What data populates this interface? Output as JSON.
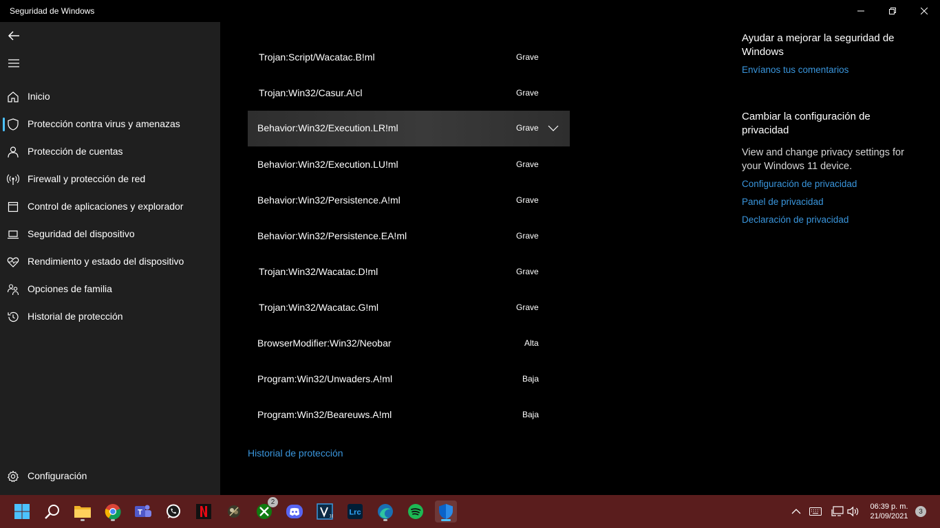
{
  "window": {
    "title": "Seguridad de Windows"
  },
  "sidebar": {
    "items": [
      {
        "label": "Inicio",
        "icon": "home-icon"
      },
      {
        "label": "Protección contra virus y amenazas",
        "icon": "shield-icon"
      },
      {
        "label": "Protección de cuentas",
        "icon": "person-icon"
      },
      {
        "label": "Firewall y protección de red",
        "icon": "antenna-icon"
      },
      {
        "label": "Control de aplicaciones y explorador",
        "icon": "app-window-icon"
      },
      {
        "label": "Seguridad del dispositivo",
        "icon": "laptop-icon"
      },
      {
        "label": "Rendimiento y estado del dispositivo",
        "icon": "heart-pulse-icon"
      },
      {
        "label": "Opciones de familia",
        "icon": "family-icon"
      },
      {
        "label": "Historial de protección",
        "icon": "history-icon"
      }
    ],
    "settings_label": "Configuración"
  },
  "threats": [
    {
      "name": "Trojan:Script/Wacatac.B!ml",
      "severity": "Grave"
    },
    {
      "name": "Trojan:Win32/Casur.A!cl",
      "severity": "Grave"
    },
    {
      "name": "Behavior:Win32/Execution.LR!ml",
      "severity": "Grave"
    },
    {
      "name": "Behavior:Win32/Execution.LU!ml",
      "severity": "Grave"
    },
    {
      "name": "Behavior:Win32/Persistence.A!ml",
      "severity": "Grave"
    },
    {
      "name": "Behavior:Win32/Persistence.EA!ml",
      "severity": "Grave"
    },
    {
      "name": "Trojan:Win32/Wacatac.D!ml",
      "severity": "Grave"
    },
    {
      "name": "Trojan:Win32/Wacatac.G!ml",
      "severity": "Grave"
    },
    {
      "name": "BrowserModifier:Win32/Neobar",
      "severity": "Alta"
    },
    {
      "name": "Program:Win32/Unwaders.A!ml",
      "severity": "Baja"
    },
    {
      "name": "Program:Win32/Beareuws.A!ml",
      "severity": "Baja"
    }
  ],
  "history_link": "Historial de protección",
  "right_panel": {
    "improve_heading": "Ayudar a mejorar la seguridad de Windows",
    "feedback_link": "Envíanos tus comentarios",
    "privacy_heading": "Cambiar la configuración de privacidad",
    "privacy_text": "View and change privacy settings for your Windows 11 device.",
    "privacy_links": [
      "Configuración de privacidad",
      "Panel de privacidad",
      "Declaración de privacidad"
    ]
  },
  "taskbar": {
    "apps": [
      "start-icon",
      "search-icon",
      "file-explorer-icon",
      "chrome-icon",
      "teams-icon",
      "whatsapp-icon",
      "netflix-icon",
      "game-app-icon",
      "xbox-icon",
      "discord-icon",
      "vegas-icon",
      "lightroom-icon",
      "browser-icon",
      "spotify-icon",
      "windows-security-icon"
    ],
    "xbox_badge": "2",
    "clock_time": "06:39 p. m.",
    "clock_date": "21/09/2021",
    "notification_count": "3"
  },
  "colors": {
    "accent": "#4cc2ff",
    "link": "#3a96dd",
    "taskbar": "#5a1d1d",
    "sidebar": "#1f1f1f"
  }
}
